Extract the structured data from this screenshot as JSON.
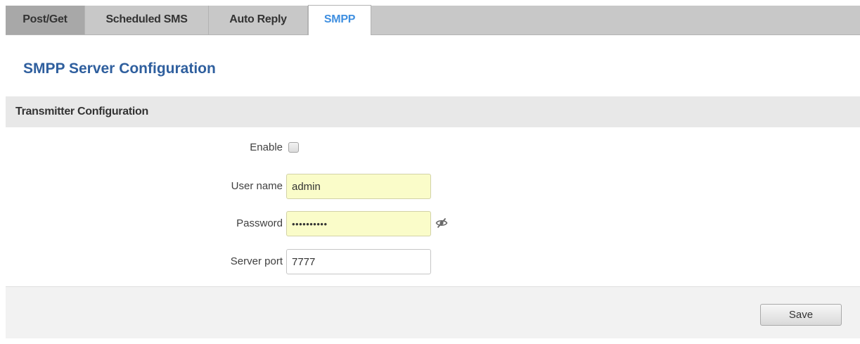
{
  "tabs": [
    {
      "label": "Post/Get",
      "active": false
    },
    {
      "label": "Scheduled SMS",
      "active": false
    },
    {
      "label": "Auto Reply",
      "active": false
    },
    {
      "label": "SMPP",
      "active": true
    }
  ],
  "page": {
    "title": "SMPP Server Configuration"
  },
  "section": {
    "title": "Transmitter Configuration"
  },
  "form": {
    "enable": {
      "label": "Enable",
      "checked": false
    },
    "username": {
      "label": "User name",
      "value": "admin"
    },
    "password": {
      "label": "Password",
      "value": "••••••••••",
      "reveal_icon": "eye-slash-icon"
    },
    "server_port": {
      "label": "Server port",
      "value": "7777"
    }
  },
  "footer": {
    "save_label": "Save"
  },
  "colors": {
    "tab_active_text": "#3f8fe0",
    "title_text": "#2f5f9e",
    "autofill_bg": "#fafcc9",
    "section_bg": "#e8e8e8"
  }
}
